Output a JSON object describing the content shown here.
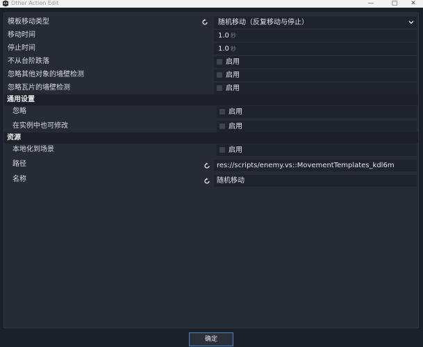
{
  "window": {
    "title": "Other Action Edit",
    "minimize": "—",
    "maximize": "□",
    "close": "✕"
  },
  "rows": {
    "template_type": {
      "label": "模板移动类型",
      "value": "随机移动（反复移动与停止）"
    },
    "move_time": {
      "label": "移动时间",
      "value": "1.0",
      "unit": "秒"
    },
    "stop_time": {
      "label": "停止时间",
      "value": "1.0",
      "unit": "秒"
    },
    "no_fall": {
      "label": "不从台阶跌落",
      "check_label": "启用"
    },
    "ignore_obj_wall": {
      "label": "忽略其他对象的墙壁检测",
      "check_label": "启用"
    },
    "ignore_tile_wall": {
      "label": "忽略瓦片的墙壁检测",
      "check_label": "启用"
    }
  },
  "general": {
    "header": "通用设置",
    "ignore": {
      "label": "忽略",
      "check_label": "启用"
    },
    "editable": {
      "label": "在实例中也可修改",
      "check_label": "启用"
    }
  },
  "resource": {
    "header": "资源",
    "localize": {
      "label": "本地化到场景",
      "check_label": "启用"
    },
    "path": {
      "label": "路径",
      "value": "res://scripts/enemy.vs::MovementTemplates_kdl6m"
    },
    "name": {
      "label": "名称",
      "value": "随机移动"
    }
  },
  "footer": {
    "ok_label": "确定"
  }
}
